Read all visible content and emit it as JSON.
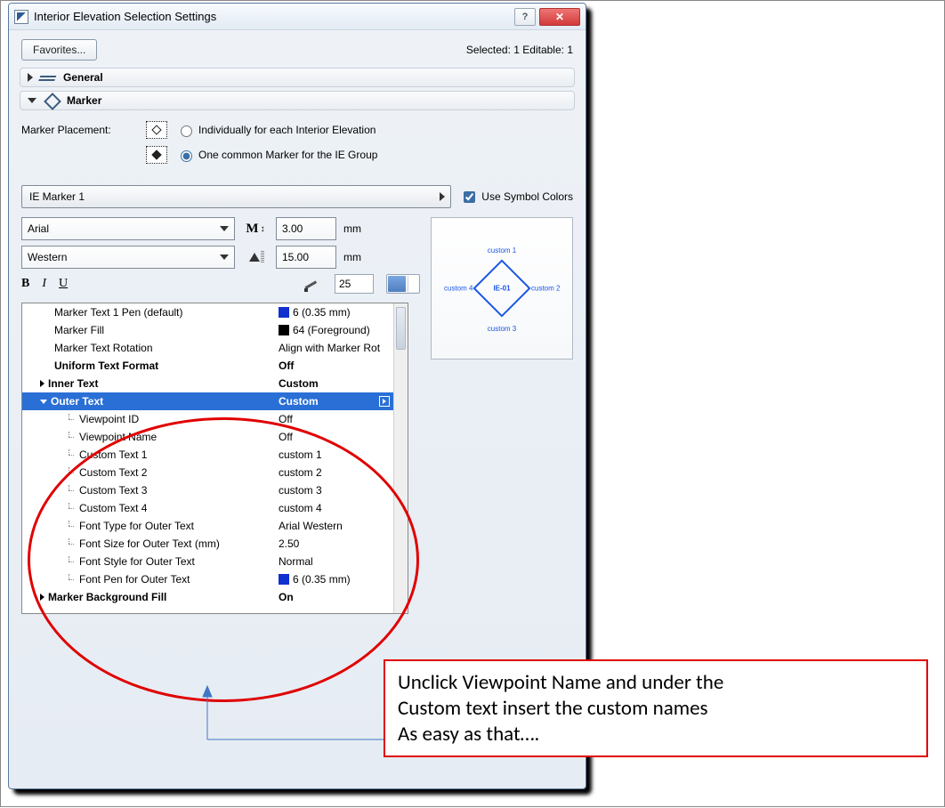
{
  "window": {
    "title": "Interior Elevation Selection Settings",
    "help": "?",
    "close": "✕"
  },
  "top": {
    "favorites": "Favorites...",
    "status": "Selected: 1 Editable: 1"
  },
  "sections": {
    "general": "General",
    "marker": "Marker"
  },
  "markerPlacement": {
    "label": "Marker Placement:",
    "opt1": "Individually for each Interior Elevation",
    "opt2": "One common Marker for the IE Group"
  },
  "markerSelect": "IE Marker 1",
  "useSymbolColors": "Use Symbol Colors",
  "font": {
    "family": "Arial",
    "script": "Western",
    "mSize": "3.00",
    "aSize": "15.00",
    "mm": "mm",
    "pen": "25"
  },
  "tree": {
    "row0": {
      "label": "Marker Text 1 Pen (default)",
      "value": "6 (0.35 mm)"
    },
    "row1": {
      "label": "Marker Fill",
      "value": "64 (Foreground)"
    },
    "row2": {
      "label": "Marker Text Rotation",
      "value": "Align with Marker Rot"
    },
    "row3": {
      "label": "Uniform Text Format",
      "value": "Off"
    },
    "row4": {
      "label": "Inner Text",
      "value": "Custom"
    },
    "row5": {
      "label": "Outer Text",
      "value": "Custom"
    },
    "row6": {
      "label": "Viewpoint ID",
      "value": "Off"
    },
    "row7": {
      "label": "Viewpoint Name",
      "value": "Off"
    },
    "row8": {
      "label": "Custom Text 1",
      "value": "custom 1"
    },
    "row9": {
      "label": "Custom Text 2",
      "value": "custom 2"
    },
    "row10": {
      "label": "Custom Text 3",
      "value": "custom 3"
    },
    "row11": {
      "label": "Custom Text 4",
      "value": "custom 4"
    },
    "row12": {
      "label": "Font Type for Outer Text",
      "value": "Arial Western"
    },
    "row13": {
      "label": "Font Size for Outer Text (mm)",
      "value": "2.50"
    },
    "row14": {
      "label": "Font Style for Outer Text",
      "value": "Normal"
    },
    "row15": {
      "label": "Font Pen for Outer Text",
      "value": "6 (0.35 mm)"
    },
    "row16": {
      "label": "Marker Background Fill",
      "value": "On"
    }
  },
  "preview": {
    "center": "IE-01",
    "top": "custom 1",
    "right": "custom 2",
    "bottom": "custom 3",
    "left": "custom 4"
  },
  "annotation": {
    "line1": "Unclick Viewpoint Name and under the",
    "line2": "Custom text insert the custom names",
    "line3": "As easy as that…."
  }
}
